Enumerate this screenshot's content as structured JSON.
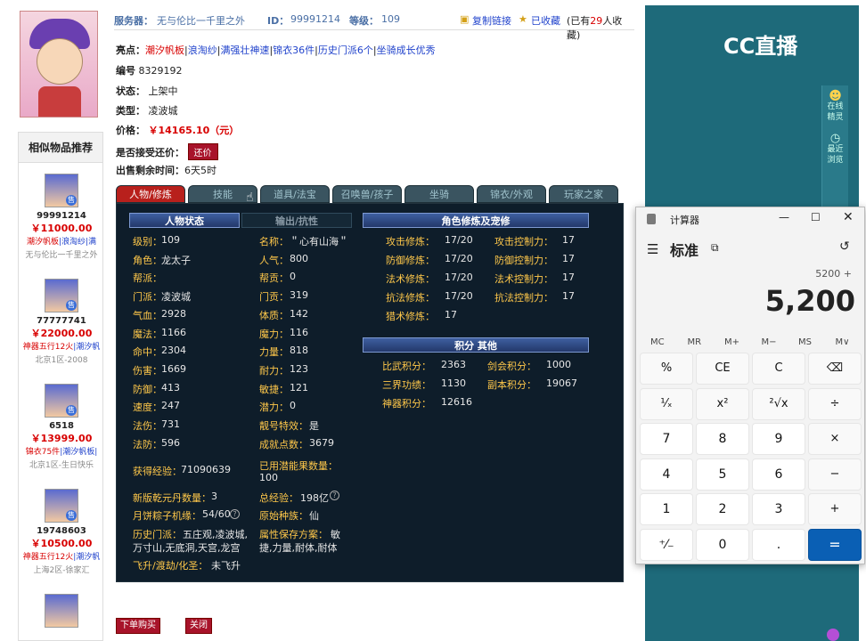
{
  "header": {
    "server_label": "服务器：",
    "server_value": "无与伦比一千里之外",
    "id_label": "ID：",
    "id_value": "99991214",
    "level_label": "等级：",
    "level_value": "109",
    "copy_link": "复制链接",
    "favorited": "已收藏",
    "fav_count_prefix": "(已有",
    "fav_count": "29",
    "fav_count_suffix": "人收藏)"
  },
  "info": {
    "highlights_label": "亮点：",
    "highlights": [
      "潮汐帆板",
      "浪淘纱",
      "满强壮神速",
      "锦衣36件",
      "历史门派6个",
      "坐骑成长优秀"
    ],
    "serial_label": "编号",
    "serial_value": "8329192",
    "status_label": "状态：",
    "status_value": "上架中",
    "type_label": "类型：",
    "type_value": "凌波城",
    "price_label": "价格：",
    "price_value": "￥14165.10（元）",
    "bargain_label": "是否接受还价：",
    "bargain_button": "还价",
    "time_left_label": "出售剩余时间：",
    "time_left_value": "6天5时"
  },
  "tabs": [
    "人物/修炼",
    "技能",
    "道具/法宝",
    "召唤兽/孩子",
    "坐骑",
    "锦衣/外观",
    "玩家之家"
  ],
  "panel": {
    "char_status": "人物状态",
    "output_resist": "输出/抗性",
    "training": "角色修炼及宠修",
    "points": "积分 其他",
    "left_stats": [
      [
        "级别：",
        "109"
      ],
      [
        "角色：",
        "龙太子"
      ],
      [
        "帮派：",
        ""
      ],
      [
        "门派：",
        "凌波城"
      ],
      [
        "气血：",
        "2928"
      ],
      [
        "魔法：",
        "1166"
      ],
      [
        "命中：",
        "2304"
      ],
      [
        "伤害：",
        "1669"
      ],
      [
        "防御：",
        "413"
      ],
      [
        "速度：",
        "247"
      ],
      [
        "法伤：",
        "731"
      ],
      [
        "法防：",
        "596"
      ]
    ],
    "mid_stats": [
      [
        "名称：",
        "＂心有山海＂"
      ],
      [
        "人气：",
        "800"
      ],
      [
        "帮贡：",
        "0"
      ],
      [
        "门贡：",
        "319"
      ],
      [
        "体质：",
        "142"
      ],
      [
        "魔力：",
        "116"
      ],
      [
        "力量：",
        "818"
      ],
      [
        "耐力：",
        "123"
      ],
      [
        "敏捷：",
        "121"
      ],
      [
        "潜力：",
        "0"
      ],
      [
        "靓号特效：",
        "是"
      ],
      [
        "成就点数：",
        "3679"
      ]
    ],
    "exp_label": "获得经验：",
    "exp_value": "71090639",
    "potential_fruit_label": "已用潜能果数量：",
    "potential_fruit_value": "100",
    "qianyuan_label": "新版乾元丹数量：",
    "qianyuan_value": "3",
    "total_exp_label": "总经验：",
    "total_exp_value": "198亿",
    "zongzi_label": "月饼粽子机缘：",
    "zongzi_value": "54/60",
    "origin_race_label": "原始种族：",
    "origin_race_value": "仙",
    "history_school_label": "历史门派：",
    "history_school_value_1": "五庄观,凌波城,",
    "history_school_value_2": "万寸山,无底洞,天宫,龙宫",
    "attr_save_label": "属性保存方案：",
    "attr_save_value_1": "敏",
    "attr_save_value_2": "捷,力量,耐体,耐体",
    "ascend_label": "飞升/渡劫/化圣：",
    "ascend_value": "未飞升",
    "training_rows": [
      [
        "攻击修炼：",
        "17/20",
        "攻击控制力：",
        "17"
      ],
      [
        "防御修炼：",
        "17/20",
        "防御控制力：",
        "17"
      ],
      [
        "法术修炼：",
        "17/20",
        "法术控制力：",
        "17"
      ],
      [
        "抗法修炼：",
        "17/20",
        "抗法控制力：",
        "17"
      ],
      [
        "猎术修炼：",
        "17",
        "",
        ""
      ]
    ],
    "points_rows": [
      [
        "比武积分：",
        "2363",
        "剑会积分：",
        "1000"
      ],
      [
        "三界功绩：",
        "1130",
        "副本积分：",
        "19067"
      ],
      [
        "神器积分：",
        "12616",
        "",
        ""
      ]
    ]
  },
  "bottom": {
    "buy": "下单购买",
    "close": "关闭"
  },
  "sidebar": {
    "title": "相似物品推荐",
    "items": [
      {
        "id": "99991214",
        "price": "￥11000.00",
        "tags": "潮汐帆板",
        "tags2": "|浪淘纱|满",
        "server": "无与伦比一千里之外"
      },
      {
        "id": "77777741",
        "price": "￥22000.00",
        "tags": "神器五行12火",
        "tags2": "|潮汐帆",
        "server": "北京1区-2008"
      },
      {
        "id": "6518",
        "price": "￥13999.00",
        "tags": "锦衣75件",
        "tags2": "|潮汐帆板|",
        "server": "北京1区-生日快乐"
      },
      {
        "id": "19748603",
        "price": "￥10500.00",
        "tags": "神器五行12火",
        "tags2": "|潮汐帆",
        "server": "上海2区-徐家汇"
      }
    ],
    "badge": "售"
  },
  "cc": {
    "logo": "CC直播",
    "online": "在线精灵",
    "recent": "最近浏览"
  },
  "calculator": {
    "title": "计算器",
    "mode": "标准",
    "expression": "5200 +",
    "display": "5,200",
    "memory": [
      "MC",
      "MR",
      "M+",
      "M−",
      "MS",
      "M∨"
    ],
    "keys": [
      [
        "%",
        "CE",
        "C",
        "⌫"
      ],
      [
        "¹⁄ₓ",
        "x²",
        "²√x",
        "÷"
      ],
      [
        "7",
        "8",
        "9",
        "×"
      ],
      [
        "4",
        "5",
        "6",
        "−"
      ],
      [
        "1",
        "2",
        "3",
        "+"
      ],
      [
        "⁺⁄₋",
        "0",
        ".",
        "="
      ]
    ]
  }
}
